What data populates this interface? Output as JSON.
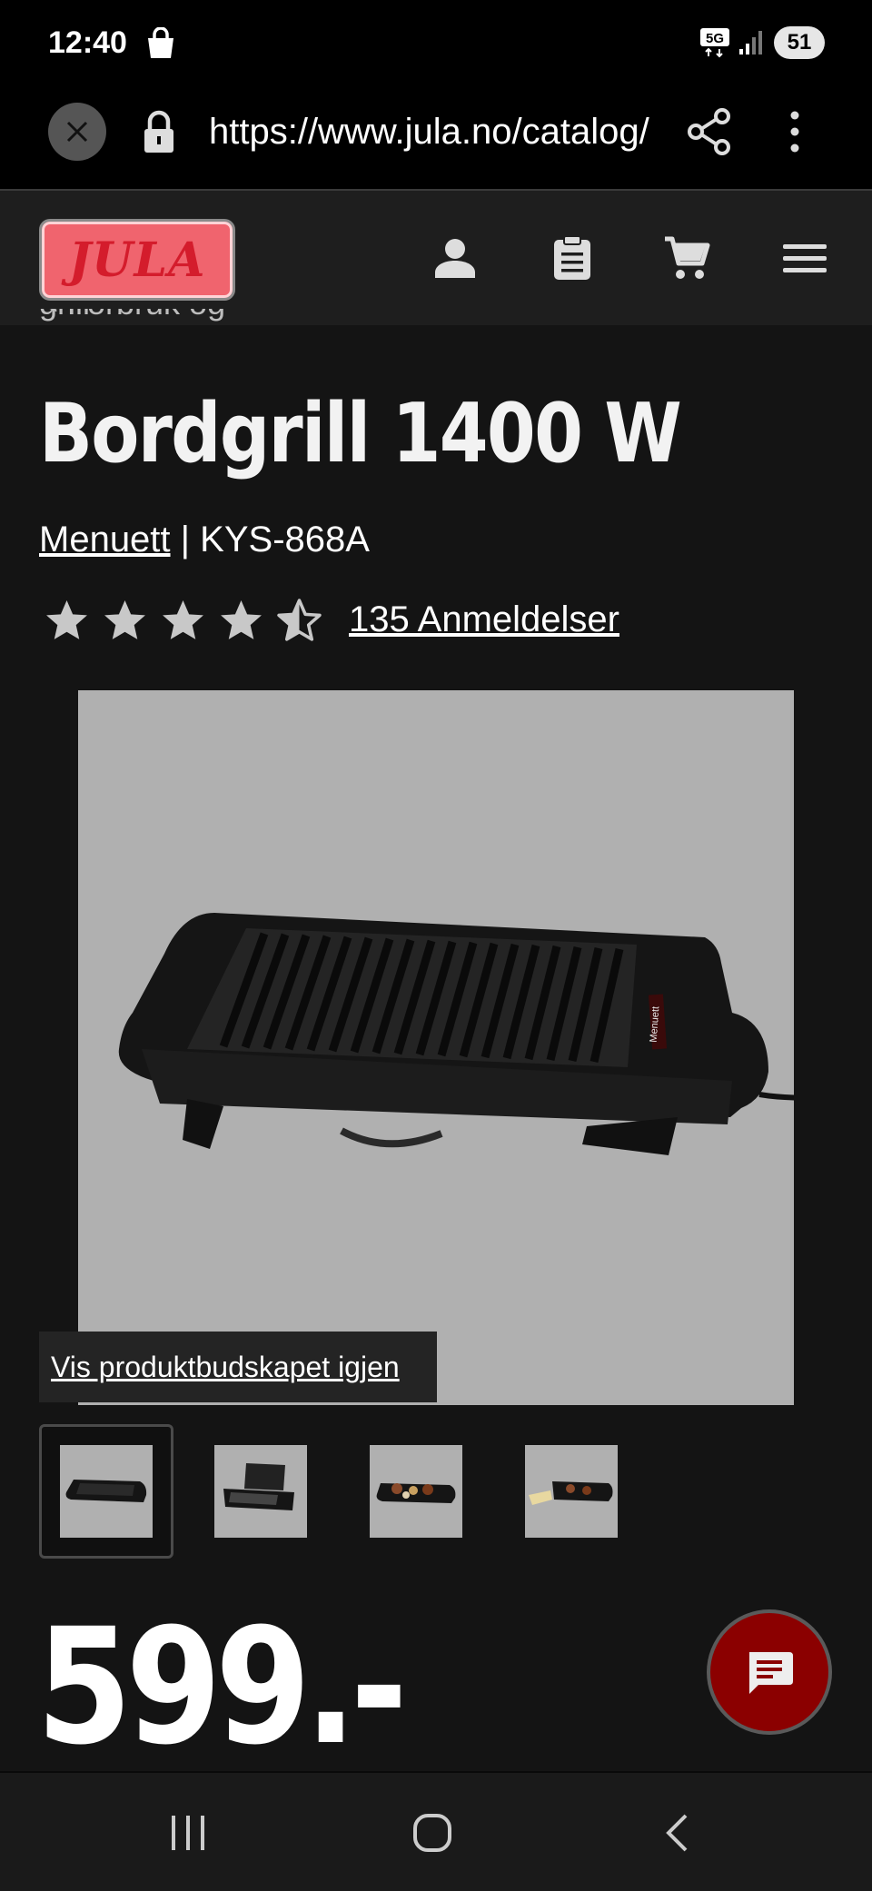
{
  "status_bar": {
    "time": "12:40",
    "network": "5G",
    "battery": "51",
    "icons": [
      "shopping-bag-icon",
      "5g-icon",
      "signal-icon",
      "battery-icon"
    ]
  },
  "browser": {
    "url": "https://www.jula.no/catalog/",
    "icons": [
      "close-icon",
      "lock-icon",
      "share-icon",
      "more-vert-icon"
    ]
  },
  "header": {
    "logo_text": "JULA",
    "icons": [
      "account-icon",
      "shopping-list-icon",
      "cart-icon",
      "menu-icon"
    ]
  },
  "breadcrumb": "< Forbruk og grill",
  "product": {
    "title": "Bordgrill 1400 W",
    "brand": "Menuett",
    "separator": " | ",
    "model": "KYS-868A",
    "rating": 4.5,
    "rating_max": 5,
    "reviews_label": "135 Anmeldelser",
    "image_alt": "Black table grill product photo",
    "image_brand_label": "Menuett",
    "restore_label": "Vis produktbudskapet igjen",
    "thumbnails": [
      "thumb-grill-front",
      "thumb-grill-open",
      "thumb-grill-food",
      "thumb-grill-food-2"
    ],
    "price": "599.-"
  },
  "colors": {
    "background": "#141414",
    "header": "#1e1e1e",
    "logo_red": "#d41c2c",
    "chat_button": "#8b0000",
    "image_bg": "#b0b0b0"
  }
}
